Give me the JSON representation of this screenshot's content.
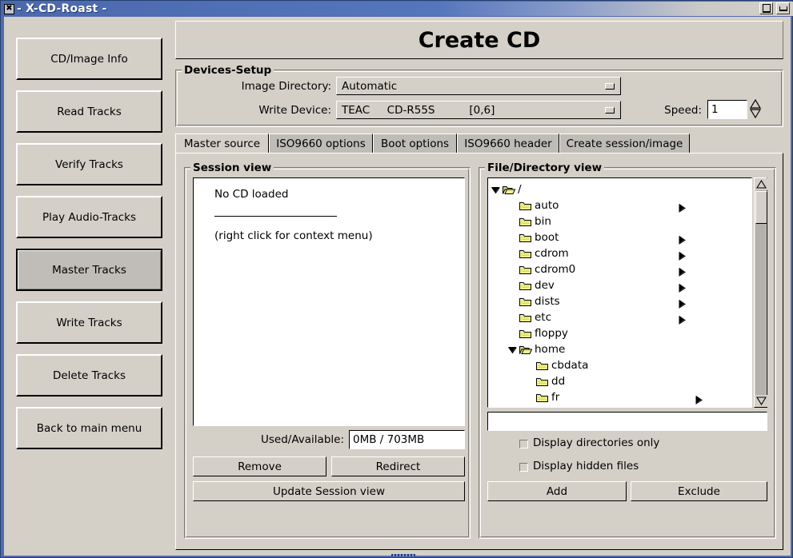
{
  "window": {
    "title": "- X-CD-Roast -",
    "icon": "close-x-icon",
    "buttons": {
      "maximize": "maximize-icon",
      "minimize": "minimize-icon"
    }
  },
  "sidebar": {
    "items": [
      {
        "label": "CD/Image Info",
        "selected": false
      },
      {
        "label": "Read Tracks",
        "selected": false
      },
      {
        "label": "Verify Tracks",
        "selected": false
      },
      {
        "label": "Play Audio-Tracks",
        "selected": false
      },
      {
        "label": "Master Tracks",
        "selected": true
      },
      {
        "label": "Write Tracks",
        "selected": false
      },
      {
        "label": "Delete Tracks",
        "selected": false
      },
      {
        "label": "Back to main menu",
        "selected": false
      }
    ]
  },
  "header": {
    "title": "Create CD"
  },
  "devices": {
    "legend": "Devices-Setup",
    "image_directory_label": "Image Directory:",
    "image_directory_value": "Automatic",
    "write_device_label": "Write Device:",
    "write_device_value": "TEAC     CD-R55S          [0,6]",
    "speed_label": "Speed:",
    "speed_value": "1"
  },
  "tabs": [
    {
      "label": "Master source",
      "active": true
    },
    {
      "label": "ISO9660 options",
      "active": false
    },
    {
      "label": "Boot options",
      "active": false
    },
    {
      "label": "ISO9660 header",
      "active": false
    },
    {
      "label": "Create session/image",
      "active": false
    }
  ],
  "session_view": {
    "legend": "Session view",
    "line1": "No CD loaded",
    "line2": "(right click for context menu)",
    "used_available_label": "Used/Available:",
    "used_available_value": "0MB / 703MB",
    "remove_button": "Remove",
    "redirect_button": "Redirect",
    "update_button": "Update Session view"
  },
  "file_view": {
    "legend": "File/Directory view",
    "path_value": "",
    "tree": [
      {
        "name": "/",
        "depth": 0,
        "expander": "down",
        "folder": "open",
        "icon": "folder-open-icon"
      },
      {
        "name": "auto",
        "depth": 1,
        "expander": "right",
        "folder": "closed",
        "icon": "folder-icon"
      },
      {
        "name": "bin",
        "depth": 1,
        "expander": "none",
        "folder": "closed",
        "icon": "folder-icon"
      },
      {
        "name": "boot",
        "depth": 1,
        "expander": "right",
        "folder": "closed",
        "icon": "folder-icon"
      },
      {
        "name": "cdrom",
        "depth": 1,
        "expander": "right",
        "folder": "closed",
        "icon": "folder-icon"
      },
      {
        "name": "cdrom0",
        "depth": 1,
        "expander": "right",
        "folder": "closed",
        "icon": "folder-icon"
      },
      {
        "name": "dev",
        "depth": 1,
        "expander": "right",
        "folder": "closed",
        "icon": "folder-icon"
      },
      {
        "name": "dists",
        "depth": 1,
        "expander": "right",
        "folder": "closed",
        "icon": "folder-icon"
      },
      {
        "name": "etc",
        "depth": 1,
        "expander": "right",
        "folder": "closed",
        "icon": "folder-icon"
      },
      {
        "name": "floppy",
        "depth": 1,
        "expander": "none",
        "folder": "closed",
        "icon": "folder-icon"
      },
      {
        "name": "home",
        "depth": 1,
        "expander": "down",
        "folder": "open",
        "icon": "folder-open-icon"
      },
      {
        "name": "cbdata",
        "depth": 2,
        "expander": "none",
        "folder": "closed",
        "icon": "folder-icon"
      },
      {
        "name": "dd",
        "depth": 2,
        "expander": "none",
        "folder": "closed",
        "icon": "folder-icon"
      },
      {
        "name": "fr",
        "depth": 2,
        "expander": "right",
        "folder": "closed",
        "icon": "folder-icon"
      }
    ],
    "checkbox_dirs_only": "Display directories only",
    "checkbox_hidden": "Display hidden files",
    "add_button": "Add",
    "exclude_button": "Exclude"
  },
  "colors": {
    "face": "#d4d0c8",
    "title_active": "#4f6cb0",
    "folder_yellow": "#e8e86a",
    "selected_button": "#c0bdb8"
  }
}
